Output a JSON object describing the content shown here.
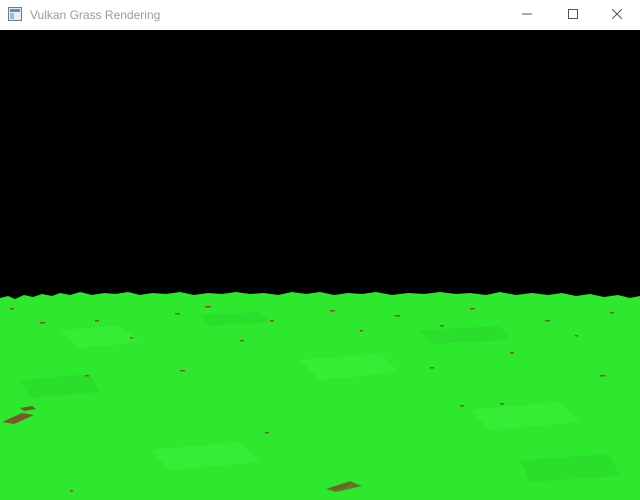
{
  "window": {
    "title": "Vulkan Grass Rendering",
    "icon": "app-window-icon",
    "controls": {
      "minimize_icon": "minimize-icon",
      "maximize_icon": "maximize-icon",
      "close_icon": "close-icon"
    }
  },
  "viewport": {
    "sky_color": "#000000",
    "grass_color": "#2ee82e",
    "soil_color": "#7a5a2a"
  }
}
